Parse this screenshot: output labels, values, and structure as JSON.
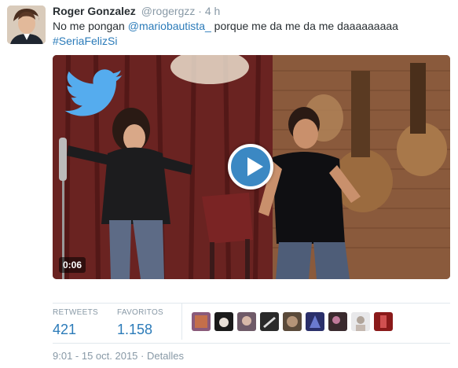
{
  "tweet": {
    "author_name": "Roger Gonzalez",
    "author_handle": "@rogergzz",
    "separator": "·",
    "time": "4 h",
    "text_before": "No me pongan ",
    "mention": "@mariobautista_",
    "text_after": " porque me da me da me daaaaaaaaa",
    "hashtag": "#SeriaFelizSi"
  },
  "media": {
    "duration": "0:06",
    "play_icon": "play-icon",
    "bird_icon": "twitter-bird-icon"
  },
  "stats": {
    "retweets_label": "RETWEETS",
    "retweets_value": "421",
    "favorites_label": "FAVORITOS",
    "favorites_value": "1.158"
  },
  "footer": {
    "timestamp": "9:01 - 15 oct. 2015",
    "separator": "·",
    "details_label": "Detalles"
  },
  "colors": {
    "link": "#2b7bb9",
    "muted": "#8899a6",
    "play_button": "#3b88c3"
  }
}
